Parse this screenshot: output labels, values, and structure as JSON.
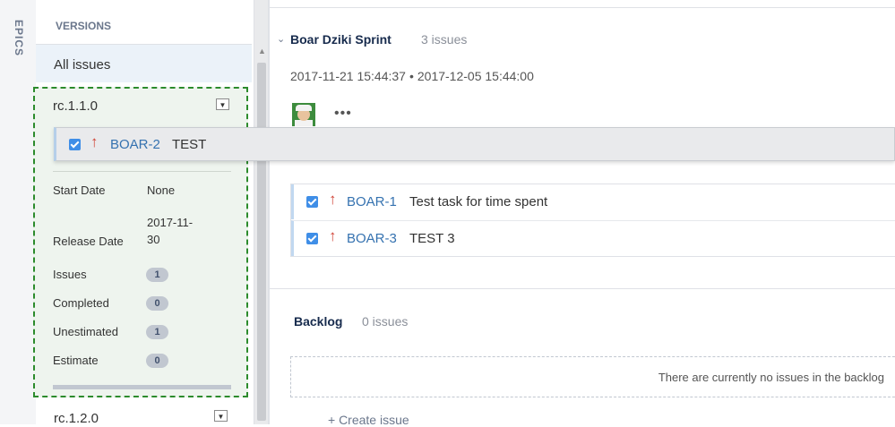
{
  "sidebar": {
    "epics_label": "EPICS"
  },
  "versions": {
    "header": "VERSIONS",
    "all_issues": "All issues",
    "selected": {
      "name": "rc.1.1.0",
      "details": {
        "start_date_label": "Start Date",
        "start_date_value": "None",
        "release_date_label": "Release Date",
        "release_date_value_line1": "2017-11-",
        "release_date_value_line2": "30",
        "issues_label": "Issues",
        "issues_count": "1",
        "completed_label": "Completed",
        "completed_count": "0",
        "unestimated_label": "Unestimated",
        "unestimated_count": "1",
        "estimate_label": "Estimate",
        "estimate_count": "0"
      }
    },
    "next": {
      "name": "rc.1.2.0"
    }
  },
  "dragged_issue": {
    "key": "BOAR-2",
    "title": "TEST"
  },
  "sprint": {
    "name": "Boar Dziki Sprint",
    "count": "3 issues",
    "start": "2017-11-21 15:44:37",
    "separator": "•",
    "end": "2017-12-05 15:44:00",
    "more": "•••",
    "issues": [
      {
        "key": "BOAR-1",
        "title": "Test task for time spent"
      },
      {
        "key": "BOAR-3",
        "title": "TEST 3"
      }
    ]
  },
  "backlog": {
    "title": "Backlog",
    "count": "0 issues",
    "empty_message": "There are currently no issues in the backlog",
    "create_issue": "+ Create issue"
  },
  "colors": {
    "accent": "#3572b0",
    "priority": "#d04437",
    "version_border": "#2c8b2c"
  },
  "icons": [
    "chevron-down-icon",
    "priority-highest-icon",
    "checkbox-checked-icon",
    "more-icon",
    "avatar"
  ]
}
